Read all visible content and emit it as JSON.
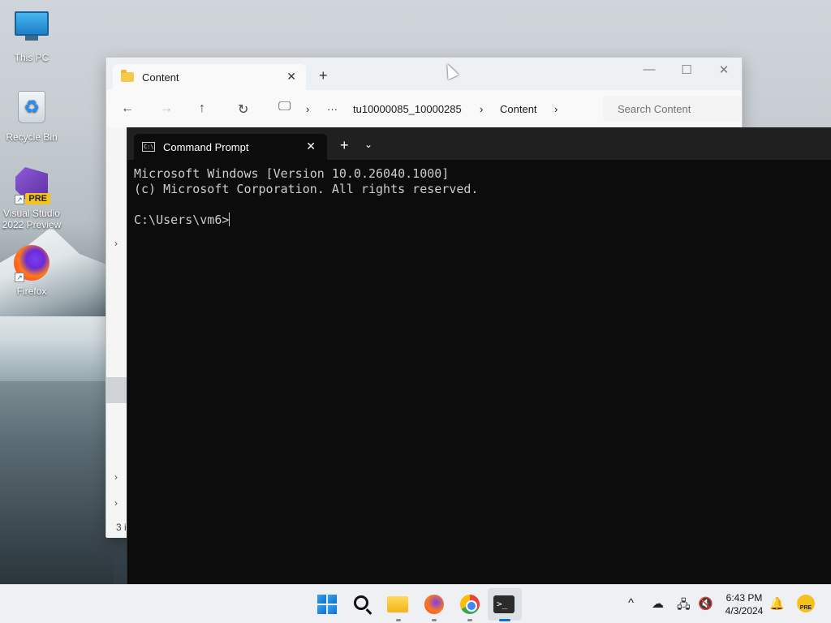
{
  "desktop": {
    "icons": [
      {
        "label": "This PC"
      },
      {
        "label": "Recycle Bin"
      },
      {
        "label": "Visual Studio 2022 Preview",
        "badge": "PRE"
      },
      {
        "label": "Firefox"
      }
    ]
  },
  "explorer": {
    "tab_title": "Content",
    "tab_close": "✕",
    "new_tab": "+",
    "minimize": "—",
    "maximize": "☐",
    "close": "✕",
    "nav": {
      "back": "←",
      "forward": "→",
      "up": "↑",
      "refresh": "↻",
      "more": "···",
      "breadcrumb": [
        "tu10000085_10000285",
        "Content"
      ],
      "search_placeholder": "Search Content"
    },
    "status_fragment": "3 i"
  },
  "terminal": {
    "tab_title": "Command Prompt",
    "tab_close": "✕",
    "new_tab": "+",
    "dropdown": "⌄",
    "lines": [
      "Microsoft Windows [Version 10.0.26040.1000]",
      "(c) Microsoft Corporation. All rights reserved.",
      "",
      "C:\\Users\\vm6>"
    ]
  },
  "taskbar": {
    "apps": [
      "start",
      "search",
      "file-explorer",
      "firefox",
      "chrome",
      "terminal"
    ],
    "active_app": "terminal",
    "tray": {
      "chevron": "^",
      "time": "6:43 PM",
      "date": "4/3/2024",
      "badge": "PRE"
    }
  },
  "colors": {
    "terminal_bg": "#0c0c0c",
    "terminal_text": "#cccccc",
    "taskbar_bg": "#eef0f3",
    "accent": "#0b6fd3"
  }
}
